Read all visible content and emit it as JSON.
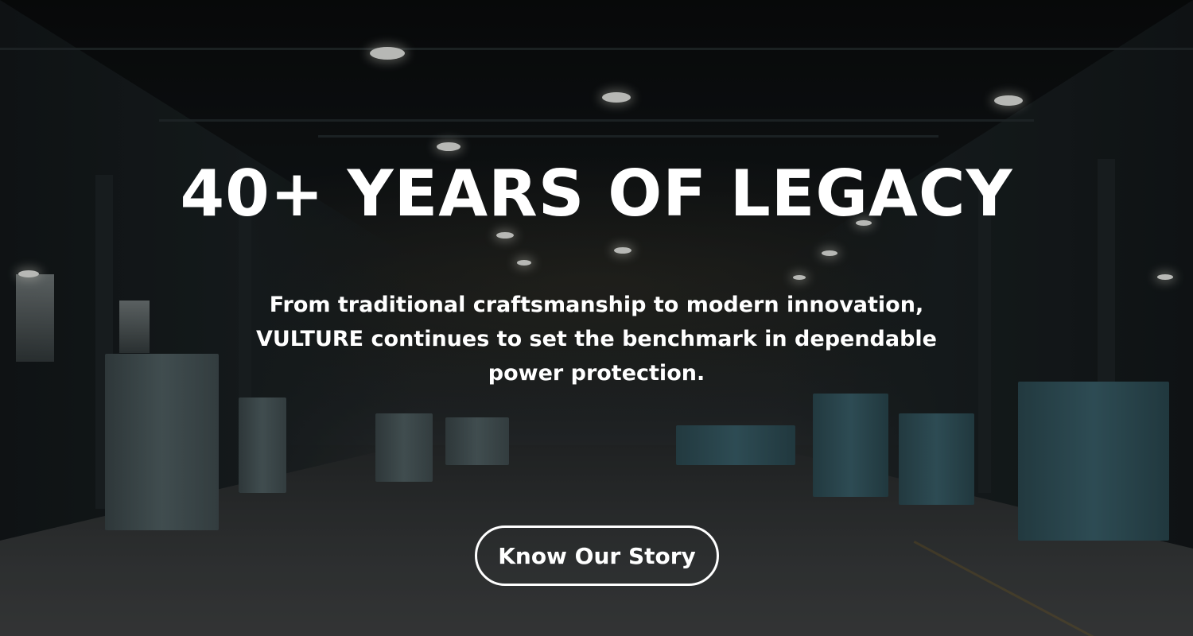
{
  "hero": {
    "headline": "40+ YEARS OF LEGACY",
    "subtext": "From traditional craftsmanship to modern innovation, VULTURE continues to set the benchmark in dependable power protection.",
    "cta_label": "Know Our Story"
  },
  "colors": {
    "text": "#ffffff",
    "button_border": "#ffffff",
    "background_tint": "#0d0f10"
  }
}
